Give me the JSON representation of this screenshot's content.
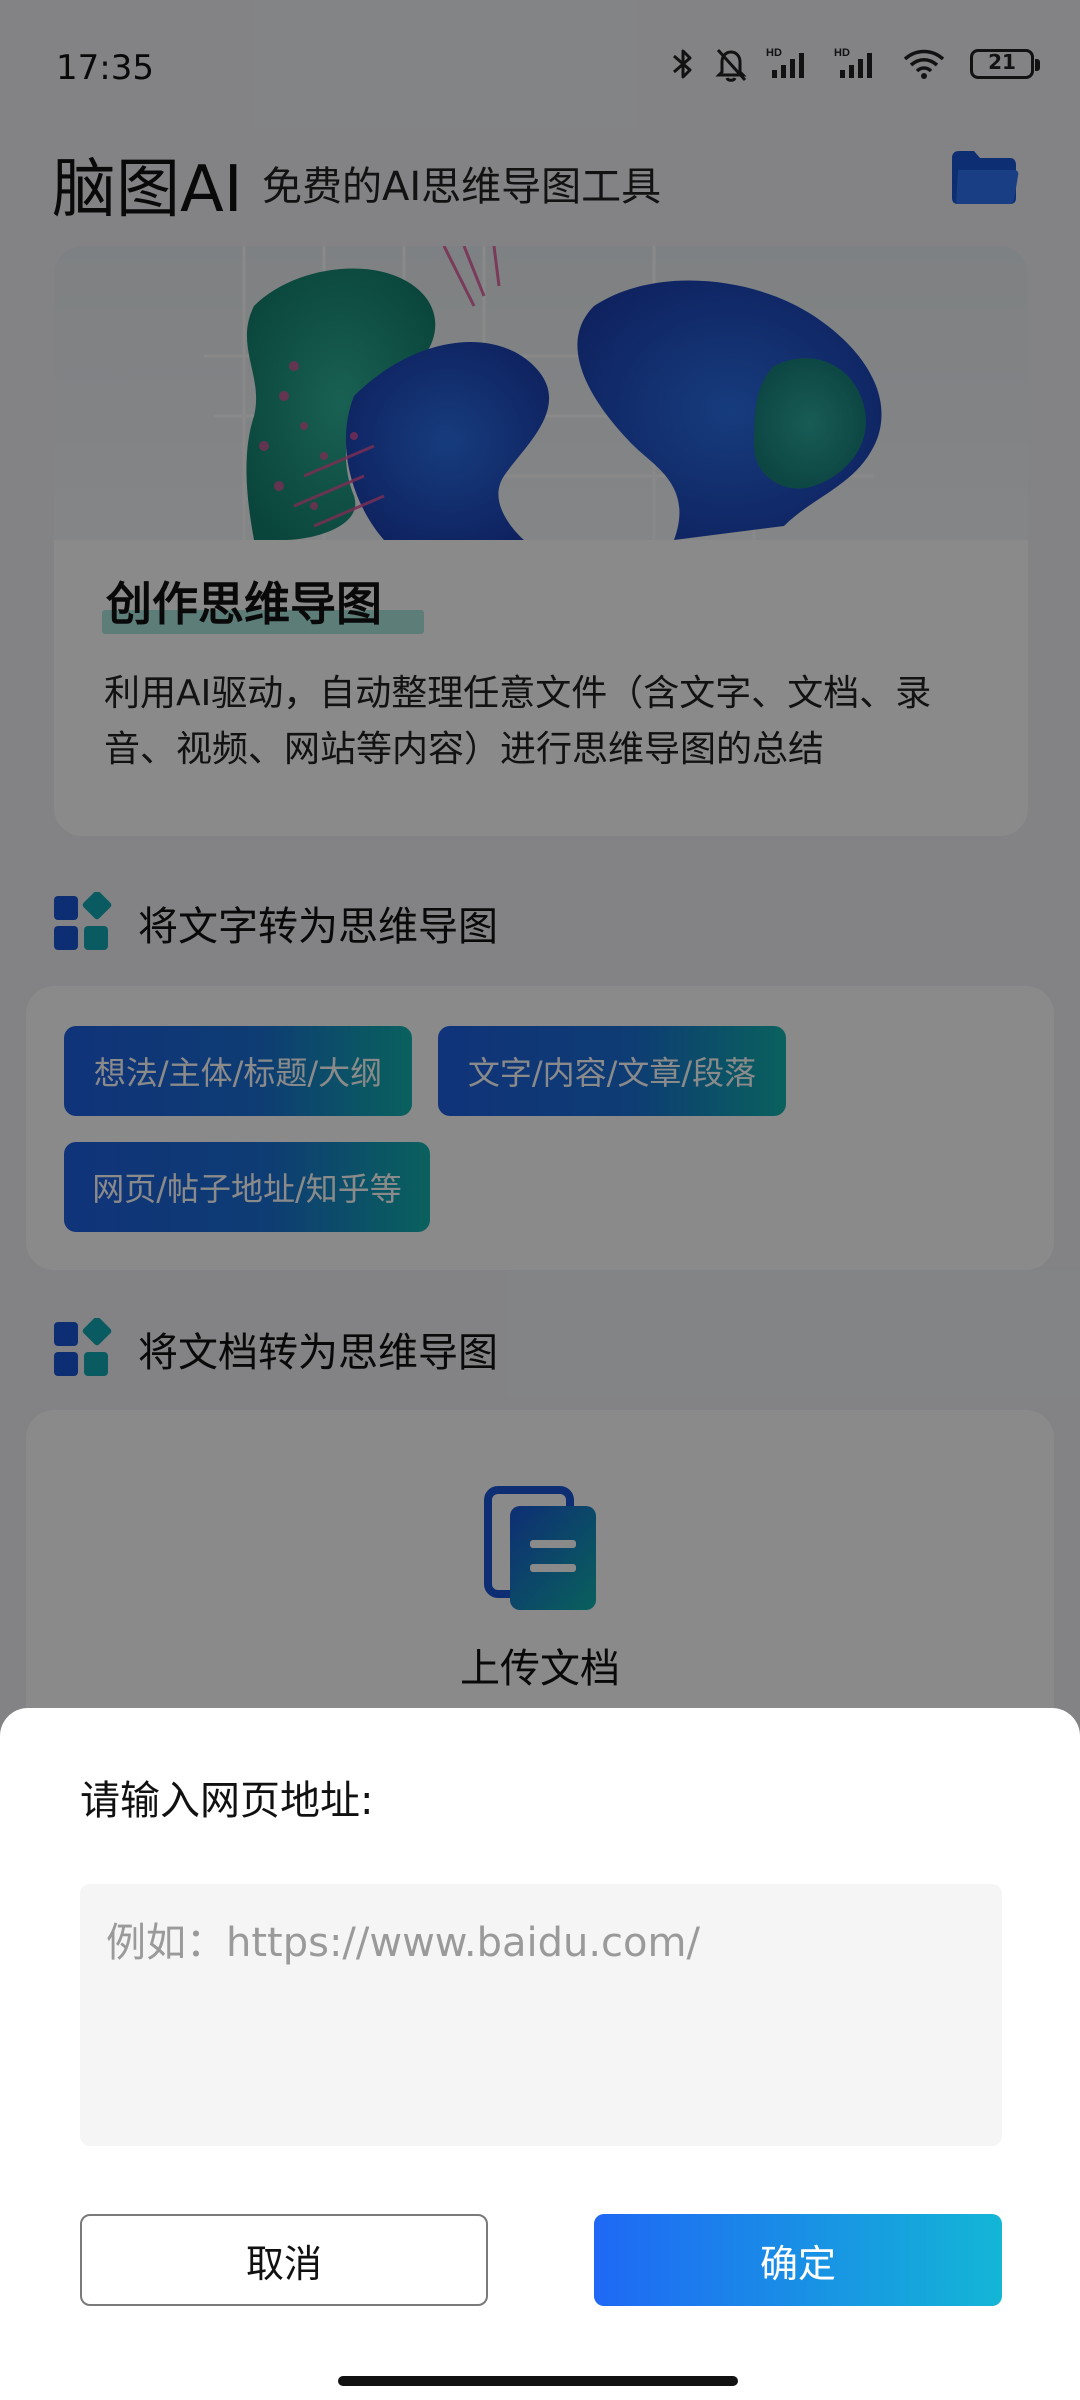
{
  "status_bar": {
    "time": "17:35",
    "battery": "21",
    "icons": [
      "bluetooth-icon",
      "mute-bell-icon",
      "signal-hd-icon",
      "signal-hd-icon",
      "wifi-icon",
      "battery-icon"
    ]
  },
  "header": {
    "title": "脑图AI",
    "subtitle": "免费的AI思维导图工具",
    "folder_icon": "folder-icon"
  },
  "hero": {
    "title": "创作思维导图",
    "description": "利用AI驱动，自动整理任意文件（含文字、文档、录音、视频、网站等内容）进行思维导图的总结"
  },
  "sections": {
    "text_to_map": {
      "title": "将文字转为思维导图",
      "chips": [
        "想法/主体/标题/大纲",
        "文字/内容/文章/段落",
        "网页/帖子地址/知乎等"
      ]
    },
    "doc_to_map": {
      "title": "将文档转为思维导图",
      "upload_label": "上传文档"
    }
  },
  "dialog": {
    "title": "请输入网页地址:",
    "input_value": "",
    "input_placeholder": "例如：https://www.baidu.com/",
    "cancel_label": "取消",
    "confirm_label": "确定"
  },
  "colors": {
    "accent_blue": "#1f68f5",
    "accent_teal": "#13b6d6",
    "overlay": "rgba(0,0,0,0.46)"
  }
}
